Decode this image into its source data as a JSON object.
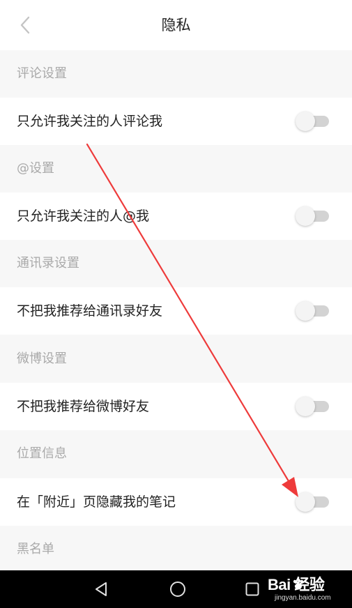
{
  "header": {
    "title": "隐私"
  },
  "sections": [
    {
      "header": "评论设置",
      "item": {
        "label": "只允许我关注的人评论我",
        "enabled": false
      }
    },
    {
      "header": "@设置",
      "item": {
        "label": "只允许我关注的人@我",
        "enabled": false
      }
    },
    {
      "header": "通讯录设置",
      "item": {
        "label": "不把我推荐给通讯录好友",
        "enabled": false
      }
    },
    {
      "header": "微博设置",
      "item": {
        "label": "不把我推荐给微博好友",
        "enabled": false
      }
    },
    {
      "header": "位置信息",
      "item": {
        "label": "在「附近」页隐藏我的笔记",
        "enabled": false
      }
    },
    {
      "header": "黑名单"
    }
  ],
  "watermark": {
    "brand": "Bai 经验",
    "url": "jingyan.baidu.com"
  },
  "colors": {
    "toggle_track": "#d3d3d3",
    "toggle_knob": "#f4f4f4",
    "annotation_arrow": "#ee3b3b",
    "section_text": "#a9a9a9",
    "navbar": "#000000"
  }
}
